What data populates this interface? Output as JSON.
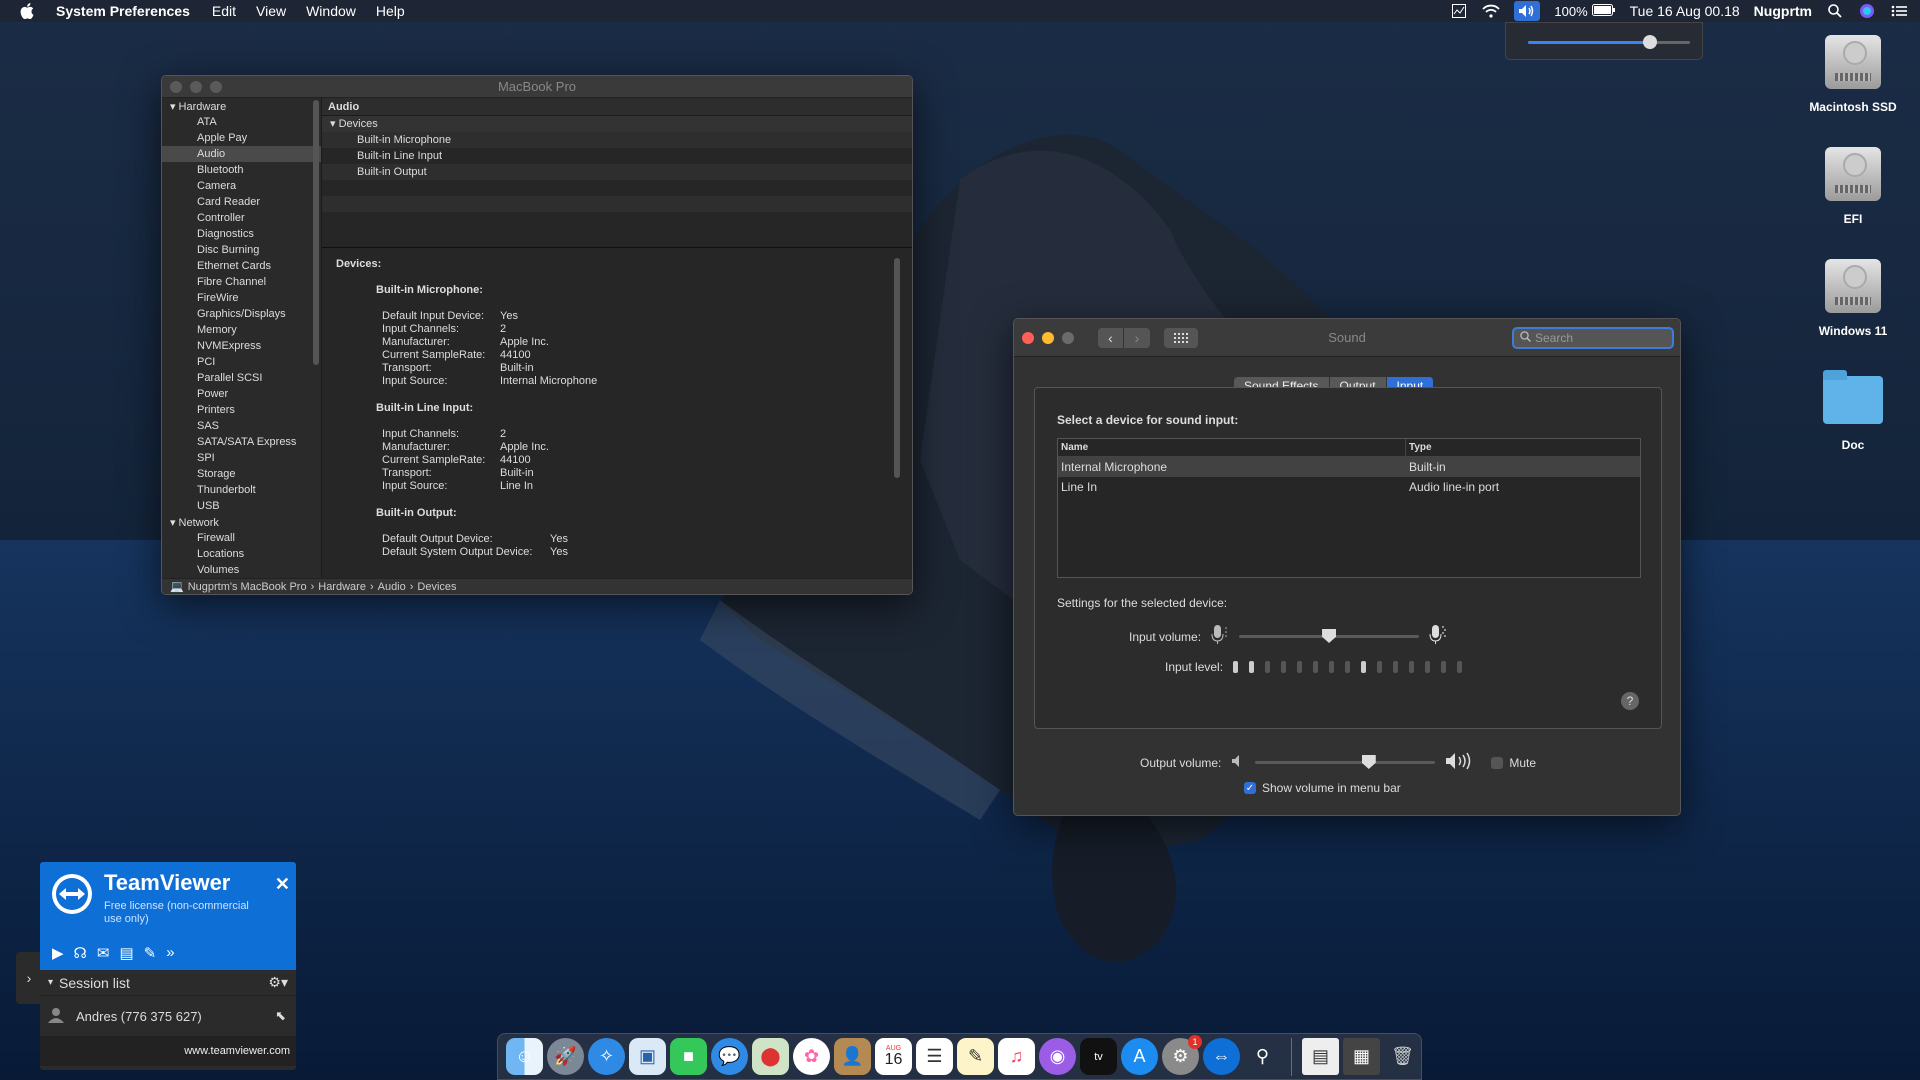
{
  "menubar": {
    "app": "System Preferences",
    "menus": [
      "Edit",
      "View",
      "Window",
      "Help"
    ],
    "battery": "100%",
    "datetime": "Tue 16 Aug  00.18",
    "user": "Nugprtm"
  },
  "volume_popover": {
    "level": 0.75
  },
  "desktop": {
    "icons": [
      {
        "label": "Macintosh SSD"
      },
      {
        "label": "EFI"
      },
      {
        "label": "Windows 11"
      },
      {
        "label": "Doc"
      }
    ]
  },
  "sysinfo": {
    "title": "MacBook Pro",
    "sidebar": {
      "hardware_label": "Hardware",
      "hardware": [
        "ATA",
        "Apple Pay",
        "Audio",
        "Bluetooth",
        "Camera",
        "Card Reader",
        "Controller",
        "Diagnostics",
        "Disc Burning",
        "Ethernet Cards",
        "Fibre Channel",
        "FireWire",
        "Graphics/Displays",
        "Memory",
        "NVMExpress",
        "PCI",
        "Parallel SCSI",
        "Power",
        "Printers",
        "SAS",
        "SATA/SATA Express",
        "SPI",
        "Storage",
        "Thunderbolt",
        "USB"
      ],
      "network_label": "Network",
      "network": [
        "Firewall",
        "Locations",
        "Volumes"
      ]
    },
    "list": {
      "header": "Audio",
      "group": "Devices",
      "items": [
        "Built-in Microphone",
        "Built-in Line Input",
        "Built-in Output"
      ]
    },
    "detail": {
      "heading": "Devices:",
      "mic": {
        "title": "Built-in Microphone:",
        "rows": [
          [
            "Default Input Device:",
            "Yes"
          ],
          [
            "Input Channels:",
            "2"
          ],
          [
            "Manufacturer:",
            "Apple Inc."
          ],
          [
            "Current SampleRate:",
            "44100"
          ],
          [
            "Transport:",
            "Built-in"
          ],
          [
            "Input Source:",
            "Internal Microphone"
          ]
        ]
      },
      "line": {
        "title": "Built-in Line Input:",
        "rows": [
          [
            "Input Channels:",
            "2"
          ],
          [
            "Manufacturer:",
            "Apple Inc."
          ],
          [
            "Current SampleRate:",
            "44100"
          ],
          [
            "Transport:",
            "Built-in"
          ],
          [
            "Input Source:",
            "Line In"
          ]
        ]
      },
      "output": {
        "title": "Built-in Output:",
        "rows": [
          [
            "Default Output Device:",
            "Yes"
          ],
          [
            "Default System Output Device:",
            "Yes"
          ]
        ]
      }
    },
    "path": [
      "Nugprtm's MacBook Pro",
      "Hardware",
      "Audio",
      "Devices"
    ]
  },
  "sound": {
    "title": "Sound",
    "search_placeholder": "Search",
    "tabs": [
      "Sound Effects",
      "Output",
      "Input"
    ],
    "select_label": "Select a device for sound input:",
    "columns": [
      "Name",
      "Type"
    ],
    "devices": [
      {
        "name": "Internal Microphone",
        "type": "Built-in"
      },
      {
        "name": "Line In",
        "type": "Audio line-in port"
      }
    ],
    "settings_label": "Settings for the selected device:",
    "input_volume_label": "Input volume:",
    "input_volume": 0.5,
    "input_level_label": "Input level:",
    "input_level_bars": 15,
    "input_level_active": 9,
    "output_volume_label": "Output volume:",
    "output_volume": 0.63,
    "mute_label": "Mute",
    "show_volume_label": "Show volume in menu bar",
    "help": "?"
  },
  "teamviewer": {
    "brand": "TeamViewer",
    "license": "Free license (non-commercial use only)",
    "session_label": "Session list",
    "user": "Andres (776 375 627)",
    "url": "www.teamviewer.com"
  },
  "dock": {
    "calendar_month": "AUG",
    "calendar_day": "16",
    "badge": "1",
    "apps": [
      "finder",
      "launchpad",
      "safari",
      "preview",
      "facetime",
      "messages",
      "maps",
      "photos",
      "contacts",
      "calendar",
      "reminders",
      "notes",
      "music",
      "podcasts",
      "tv",
      "app-store",
      "system-preferences",
      "teamviewer",
      "utility",
      "documents",
      "screenshots",
      "trash"
    ]
  }
}
